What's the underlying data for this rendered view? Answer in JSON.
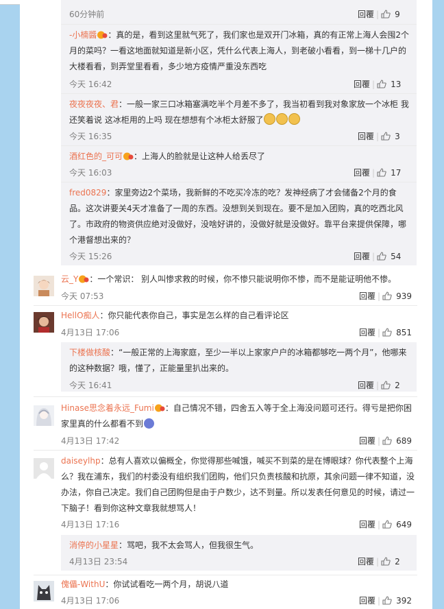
{
  "colors": {
    "username": "#eb7350",
    "time": "#808080",
    "text": "#333333",
    "page_bg": "#a9d3ef",
    "reply_bg": "#f2f2f5"
  },
  "action_reply": "回覆",
  "icons": {
    "like": "like-thumb-icon",
    "vip": "vip-badge-icon",
    "emoji": "laugh-cry-emoji"
  },
  "top_reply": {
    "time": "60分钟前",
    "likes": "9"
  },
  "replies_a": [
    {
      "user": "-小楠醬",
      "text": "：真的是，看到这里就气死了，我们家也是双开门冰箱，真的有正常上海人会囤2个月的菜吗？一看这地面就知道是新小区，凭什么代表上海人，到老破小看看，到一梯十几户的大楼看看，到弄堂里看看，多少地方疫情严重没东西吃",
      "time": "今天 16:42",
      "likes": "13"
    },
    {
      "user": "夜夜夜夜、君",
      "text": "：一般一家三口冰箱塞满吃半个月差不多了，我当初看到我对象家放一个冰柜 我还笑着说 这冰柜用的上吗 现在想想有个冰柜太舒服了",
      "time": "今天 16:35",
      "likes": "3"
    },
    {
      "user": "酒红色的_可可",
      "text": "：上海人的脸就是让这种人给丢尽了",
      "time": "今天 16:03",
      "likes": "17"
    },
    {
      "user": "fred0829",
      "text": "：家里旁边2个菜场，我新鲜的不吃买冷冻的吃？发神经病了才会储备2个月的食品。这次讲要关4天才准备了一周的东西。没想到关到现在。要不是加入团购，真的吃西北风了。市政府的物资供应绝对没做好，没啥好讲的，没做好就是没做好。靠平台来提供保障，哪个港督想出来的？",
      "time": "今天 15:26",
      "likes": "54"
    }
  ],
  "comments": [
    {
      "user": "云_Y",
      "text": "：一个常识： 别人叫惨求救的时候，你不惨只能说明你不惨，而不是能证明他不惨。",
      "time": "今天 07:53",
      "likes": "939"
    },
    {
      "user": "HellO痴人",
      "text": "：你只能代表你自己，事实是怎么样的自己看评论区",
      "time": "4月13日 17:06",
      "likes": "851"
    },
    {
      "user": "Hinase思念着永远_Fumi",
      "text": "：自己情况不错，四舍五入等于全上海没问题可还行。得亏是把你困家里真的什么都看不到",
      "time": "4月13日 17:42",
      "likes": "689"
    },
    {
      "user": "daiseylhp",
      "text": "：总有人喜欢以偏概全，你觉得那些喊饿，喊买不到菜的是在博眼球？你代表整个上海么？我在浦东，我们的村委没有组织我们团购，他们只负责核酸和抗原，其余问题一律不知道，没办法，你自己决定。我们自己团购但是由于户数少，达不到量。所以发表任何意见的时候，请过一下脑子！看到你这种文章我就想骂人！",
      "time": "4月13日 17:16",
      "likes": "649"
    },
    {
      "user": "傀儡-WithU",
      "text": "：你试试看吃一两个月，胡说八道",
      "time": "4月13日 17:06",
      "likes": "392"
    }
  ],
  "sub_replies": [
    {
      "user": "下楼做核酸",
      "text": "：“一般正常的上海家庭，至少一半以上家家户户的冰箱都够吃一两个月”，他哪来的这种数据？哦，懂了，正能量里扒出来的。",
      "time": "今天 16:41",
      "likes": "2"
    },
    {
      "user": "消停的小星星",
      "text": "：骂吧，我不太会骂人，但我很生气。",
      "time": "4月13日 23:54",
      "likes": "2"
    }
  ]
}
